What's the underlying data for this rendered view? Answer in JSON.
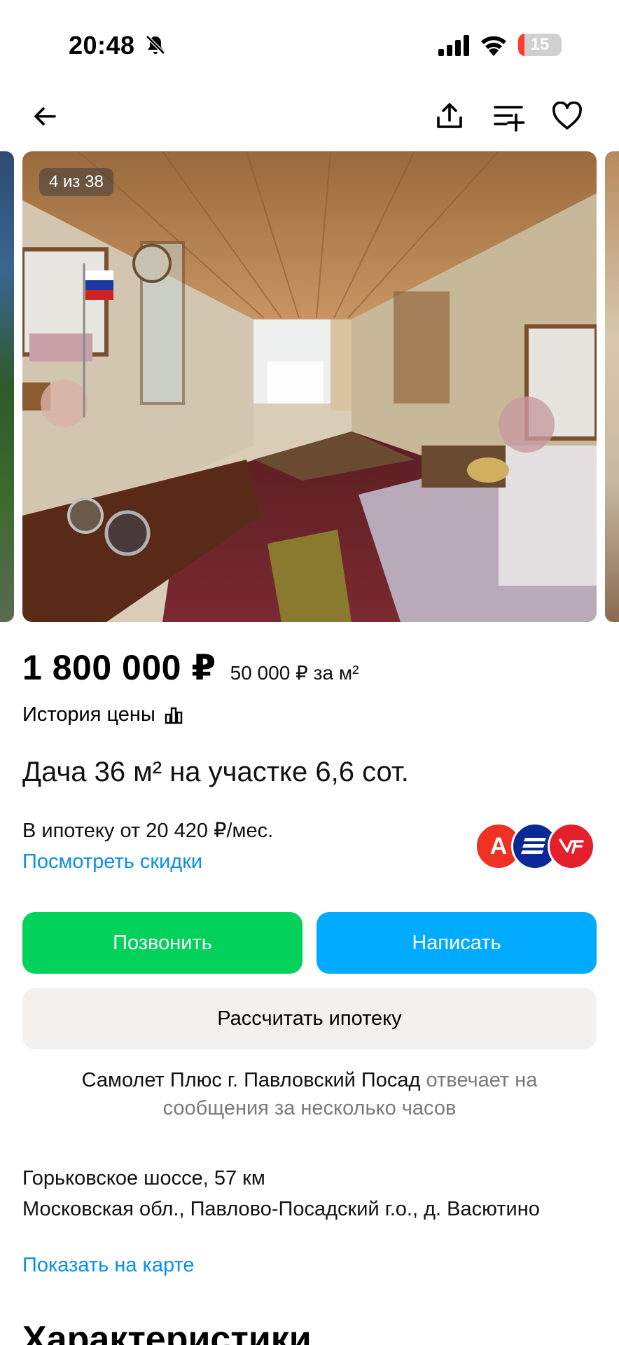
{
  "status": {
    "time": "20:48",
    "battery": "15",
    "battery_level": 0.15
  },
  "toolbar": {
    "icons": [
      "back-arrow-icon",
      "share-icon",
      "compare-icon",
      "heart-icon"
    ]
  },
  "gallery": {
    "counter": "4 из 38"
  },
  "listing": {
    "price": "1 800 000 ₽",
    "price_per_m2": "50 000 ₽ за м²",
    "price_history": "История цены",
    "title": "Дача 36 м² на участке 6,6 сот.",
    "mortgage": "В ипотеку от 20 420 ₽/мес.",
    "discounts_link": "Посмотреть скидки",
    "banks": [
      {
        "name": "alfa",
        "letter": "А",
        "color": "#ef3124"
      },
      {
        "name": "vtb",
        "color": "#0a2896"
      },
      {
        "name": "psb",
        "color": "#e4202d"
      }
    ]
  },
  "actions": {
    "call": "Позвонить",
    "write": "Написать",
    "calc": "Рассчитать ипотеку"
  },
  "seller": {
    "name": "Самолет Плюс г. Павловский Посад",
    "response": "отвечает на сообщения за несколько часов"
  },
  "address": {
    "highway": "Горьковское шоссе, 57 км",
    "full": "Московская обл., Павлово-Посадский г.о., д. Васютино",
    "map_link": "Показать на карте"
  },
  "section": {
    "heading": "Характеристики"
  },
  "colors": {
    "call_green": "#02d15c",
    "write_blue": "#00aaff",
    "link_blue": "#0a8ee8"
  }
}
